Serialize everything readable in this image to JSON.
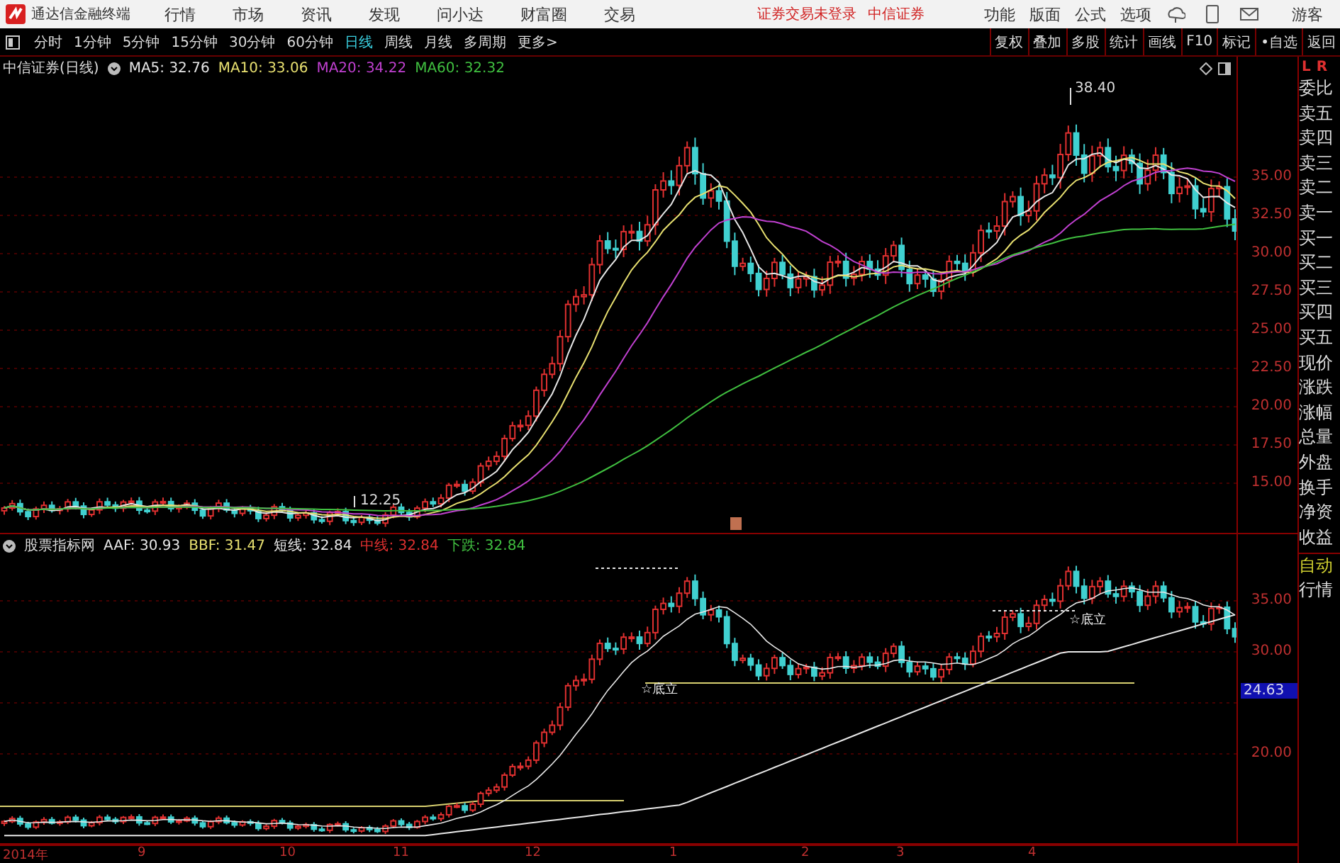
{
  "app_bar": {
    "title": "通达信金融终端",
    "menus": [
      "行情",
      "市场",
      "资讯",
      "发现",
      "问小达",
      "财富圈",
      "交易"
    ],
    "login_status": "证券交易未登录",
    "broker": "中信证券",
    "tools": [
      "功能",
      "版面",
      "公式",
      "选项"
    ],
    "user": "游客"
  },
  "period_tabs": [
    {
      "label": "分时",
      "selected": false
    },
    {
      "label": "1分钟",
      "selected": false
    },
    {
      "label": "5分钟",
      "selected": false
    },
    {
      "label": "15分钟",
      "selected": false
    },
    {
      "label": "30分钟",
      "selected": false
    },
    {
      "label": "60分钟",
      "selected": false
    },
    {
      "label": "日线",
      "selected": true
    },
    {
      "label": "周线",
      "selected": false
    },
    {
      "label": "月线",
      "selected": false
    },
    {
      "label": "多周期",
      "selected": false
    },
    {
      "label": "更多>",
      "selected": false
    }
  ],
  "toolbar_buttons": [
    "复权",
    "叠加",
    "多股",
    "统计",
    "画线",
    "F10",
    "标记",
    "•自选",
    "返回"
  ],
  "price_pane": {
    "title": "中信证券(日线)",
    "indicators": [
      {
        "label": "MA5: 32.76",
        "color": "#e6e6e6"
      },
      {
        "label": "MA10: 33.06",
        "color": "#e8e070"
      },
      {
        "label": "MA20: 34.22",
        "color": "#c040d0"
      },
      {
        "label": "MA60: 32.32",
        "color": "#40c040"
      }
    ],
    "axis_labels": [
      "35.00",
      "32.50",
      "30.00",
      "27.50",
      "25.00",
      "22.50",
      "20.00",
      "17.50",
      "15.00"
    ],
    "annotations": [
      "38.40",
      "12.25"
    ]
  },
  "indicator_pane": {
    "title": "股票指标网",
    "indicators": [
      {
        "label": "AAF: 30.93",
        "color": "#e6e6e6"
      },
      {
        "label": "BBF: 31.47",
        "color": "#e8e070"
      },
      {
        "label": "短线: 32.84",
        "color": "#e6e6e6"
      },
      {
        "label": "中线: 32.84",
        "color": "#e03030"
      },
      {
        "label": "下跌: 32.84",
        "color": "#40c040"
      }
    ],
    "axis_labels": [
      "35.00",
      "30.00",
      "20.00"
    ],
    "current_value": "24.63",
    "annotations": [
      "☆底立",
      "☆底立"
    ]
  },
  "date_axis": [
    "2014年",
    "9",
    "10",
    "11",
    "12",
    "1",
    "2",
    "3",
    "4"
  ],
  "quote_panel": {
    "header": [
      "L",
      "R"
    ],
    "fields": [
      "委比",
      "卖五",
      "卖四",
      "卖三",
      "卖二",
      "卖一",
      "买一",
      "买二",
      "买三",
      "买四",
      "买五",
      "现价",
      "涨跌",
      "涨幅",
      "总量",
      "外盘",
      "换手",
      "净资",
      "收益"
    ],
    "footer": [
      "自动",
      "行情"
    ]
  }
}
